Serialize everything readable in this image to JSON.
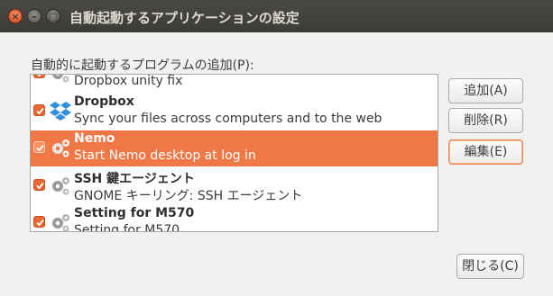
{
  "window": {
    "title": "自動起動するアプリケーションの設定",
    "close_glyph": "×",
    "minimize_glyph": "–",
    "maximize_glyph": "□"
  },
  "list_label": "自動的に起動するプログラムの追加(P):",
  "programs": [
    {
      "name": "",
      "description": "Dropbox unity fix",
      "checked": true,
      "icon": "gears-icon"
    },
    {
      "name": "Dropbox",
      "description": "Sync your files across computers and to the web",
      "checked": true,
      "icon": "dropbox-icon"
    },
    {
      "name": "Nemo",
      "description": "Start Nemo desktop at log in",
      "checked": true,
      "selected": true,
      "icon": "gears-icon"
    },
    {
      "name": "SSH 鍵エージェント",
      "description": "GNOME キーリング: SSH エージェント",
      "checked": true,
      "icon": "gears-icon"
    },
    {
      "name": "Setting for M570",
      "description": "Setting for M570",
      "checked": true,
      "icon": "gears-icon"
    }
  ],
  "buttons": {
    "add": "追加(A)",
    "remove": "削除(R)",
    "edit": "編集(E)",
    "close": "閉じる(C)"
  },
  "colors": {
    "selection": "#f07746",
    "checkbox": "#ea6632",
    "titlebar": "#3c3b37"
  }
}
